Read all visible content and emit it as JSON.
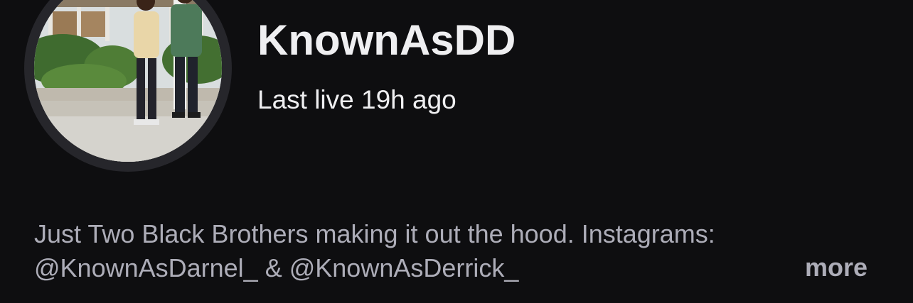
{
  "profile": {
    "display_name": "KnownAsDD",
    "status": "Last live 19h ago",
    "avatar": "profile-photo-two-men"
  },
  "about": {
    "bio_line_1": "Just Two Black Brothers making it out the hood. Instagrams:",
    "bio_line_2": "@KnownAsDarnel_ & @KnownAsDerrick_",
    "more_label": "more"
  },
  "colors": {
    "background": "#0e0e10",
    "primary_text": "#efeff1",
    "secondary_text": "#adadb8",
    "avatar_ring": "#26262b"
  }
}
